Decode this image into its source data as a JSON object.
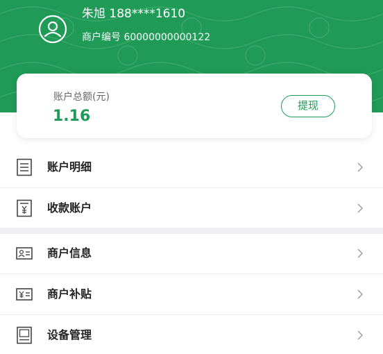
{
  "colors": {
    "brand_green": "#1f9b57",
    "card_bg": "#ffffff",
    "divider": "#ededed",
    "gap": "#efeff3"
  },
  "header": {
    "avatar_icon": "user-circle-icon",
    "name_line": "朱旭 188****1610",
    "merchant_line": "商户编号 60000000000122"
  },
  "balance_card": {
    "label": "账户总额(元)",
    "amount": "1.16",
    "withdraw_label": "提现"
  },
  "menu_group_1": [
    {
      "label": "账户明细",
      "icon": "document-list-icon"
    },
    {
      "label": "收款账户",
      "icon": "yuan-document-icon"
    }
  ],
  "menu_group_2": [
    {
      "label": "商户信息",
      "icon": "id-card-icon"
    },
    {
      "label": "商户补贴",
      "icon": "yuan-card-icon"
    },
    {
      "label": "设备管理",
      "icon": "pos-device-icon"
    }
  ]
}
